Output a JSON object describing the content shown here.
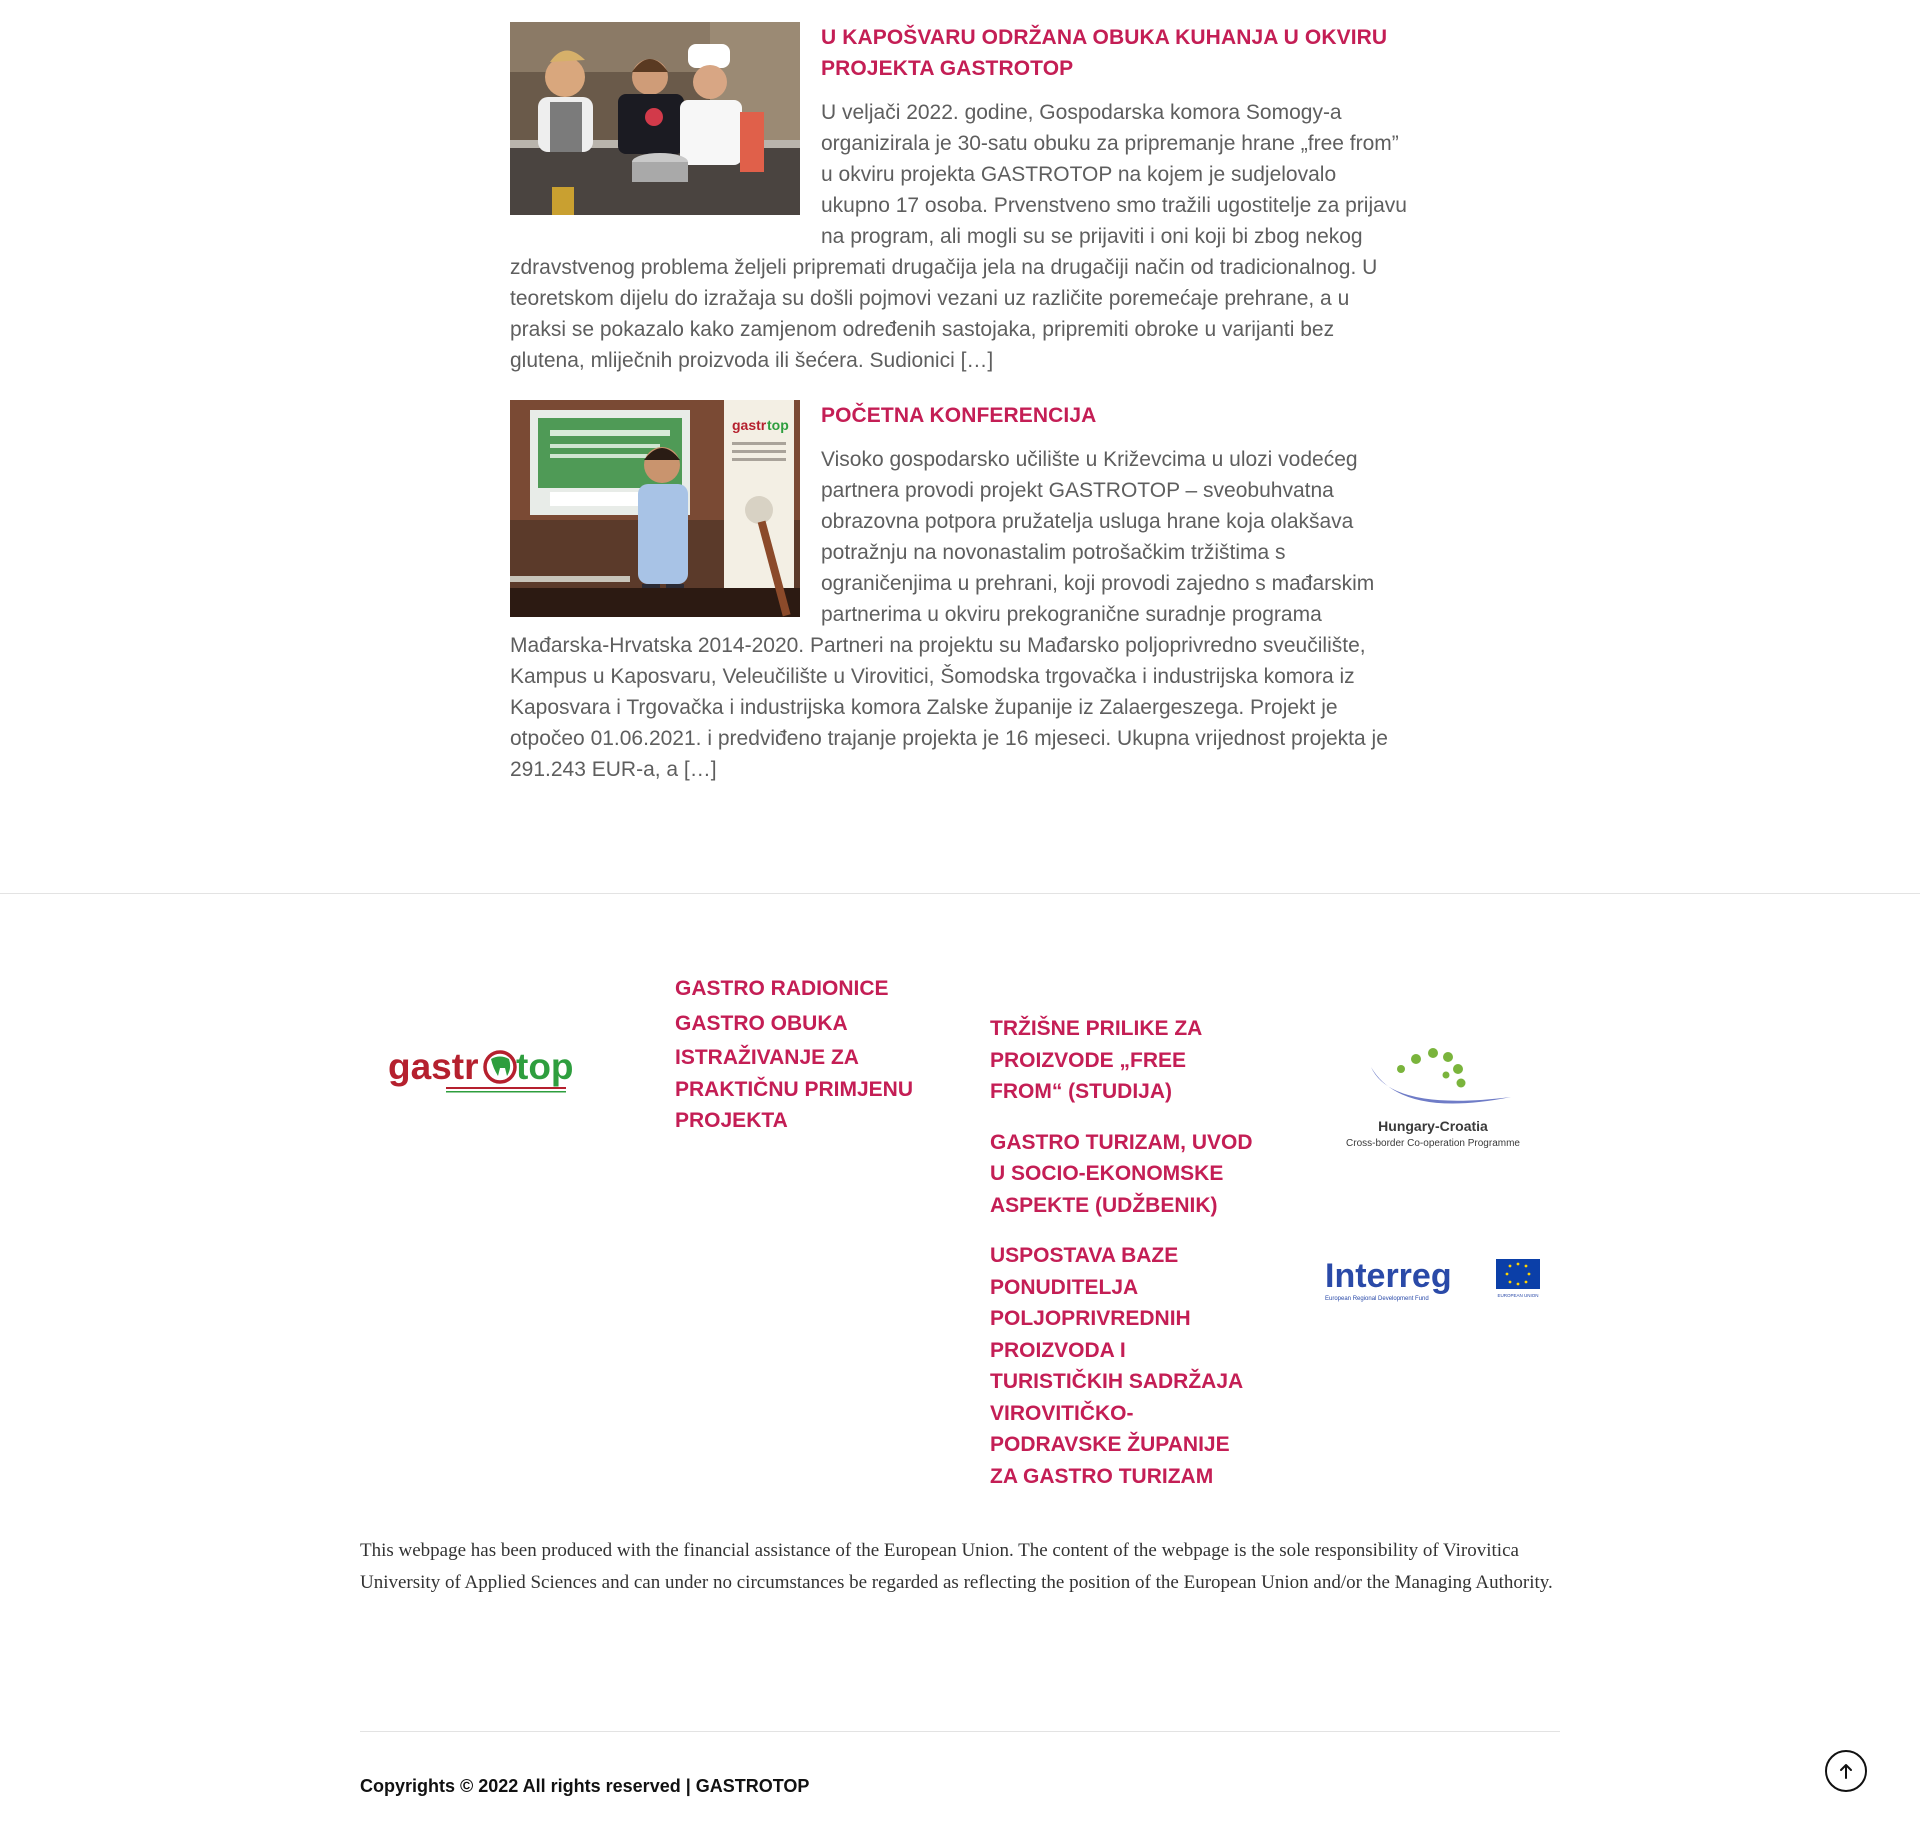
{
  "posts": [
    {
      "title": "U KAPOŠVARU ODRŽANA OBUKA KUHANJA U OKVIRU PROJEKTA GASTROTOP",
      "excerpt": "U veljači 2022. godine, Gospodarska komora Somogy-a organizirala je 30-satu obuku za pripremanje hrane „free from” u okviru projekta GASTROTOP na kojem je sudjelovalo ukupno 17 osoba. Prvenstveno smo tražili ugostitelje za prijavu na program, ali mogli su se prijaviti i oni koji bi zbog nekog zdravstvenog problema željeli pripremati drugačija jela na drugačiji način od tradicionalnog. U teoretskom dijelu do izražaja su došli pojmovi vezani uz različite poremećaje prehrane, a u praksi se pokazalo kako zamjenom određenih sastojaka, pripremiti obroke u varijanti bez glutena, mliječnih proizvoda ili šećera. Sudionici […]"
    },
    {
      "title": "POČETNA KONFERENCIJA",
      "excerpt": "Visoko gospodarsko učilište u Križevcima u ulozi vodećeg partnera provodi projekt GASTROTOP – sveobuhvatna obrazovna potpora pružatelja usluga hrane koja olakšava potražnju na novonastalim potrošačkim tržištima s ograničenjima u prehrani, koji provodi zajedno s mađarskim partnerima u okviru prekogranične suradnje programa Mađarska-Hrvatska 2014-2020. Partneri na projektu su Mađarsko poljoprivredno sveučilište, Kampus u Kaposvaru, Veleučilište u Virovitici, Šomodska trgovačka i industrijska komora iz Kaposvara i Trgovačka i industrijska komora Zalske županije iz Zalaergeszega. Projekt je otpočeo 01.06.2021. i predviđeno trajanje projekta je 16 mjeseci. Ukupna vrijednost projekta je 291.243 EUR-a, a […]"
    }
  ],
  "footer": {
    "logo_text_left": "gastr",
    "logo_text_right": "top",
    "col_a": [
      "GASTRO RADIONICE",
      "GASTRO OBUKA",
      "ISTRAŽIVANJE ZA PRAKTIČNU PRIMJENU PROJEKTA"
    ],
    "col_b": [
      "TRŽIŠNE PRILIKE ZA PROIZVODE „FREE FROM“ (STUDIJA)",
      "GASTRO TURIZAM, UVOD U SOCIO-EKONOMSKE ASPEKTE (UDŽBENIK)",
      "USPOSTAVA BAZE PONUDITELJA POLJOPRIVREDNIH PROIZVODA I TURISTIČKIH SADRŽAJA VIROVITIČKO-PODRAVSKE ŽUPANIJE ZA GASTRO TURIZAM"
    ],
    "hc_title": "Hungary-Croatia",
    "hc_sub": "Cross-border Co-operation Programme",
    "interreg_word": "Interreg",
    "interreg_fund": "European Regional Development Fund",
    "interreg_eu": "EUROPEAN UNION",
    "disclaimer": "This webpage has been produced with the financial assistance of the European Union. The content of the webpage is the sole responsibility of Virovitica University of Applied Sciences and can under no circumstances be regarded as reflecting the position of the European Union and/or the Managing Authority.",
    "copyright": "Copyrights © 2022 All rights reserved | GASTROTOP"
  },
  "colors": {
    "accent": "#c41e55",
    "logo_red": "#b5202e",
    "logo_green": "#2e9e3e",
    "interreg_blue": "#2a4aa8",
    "eu_blue": "#0b3fa8"
  },
  "icons": {
    "back_to_top": "arrow-up-icon"
  }
}
